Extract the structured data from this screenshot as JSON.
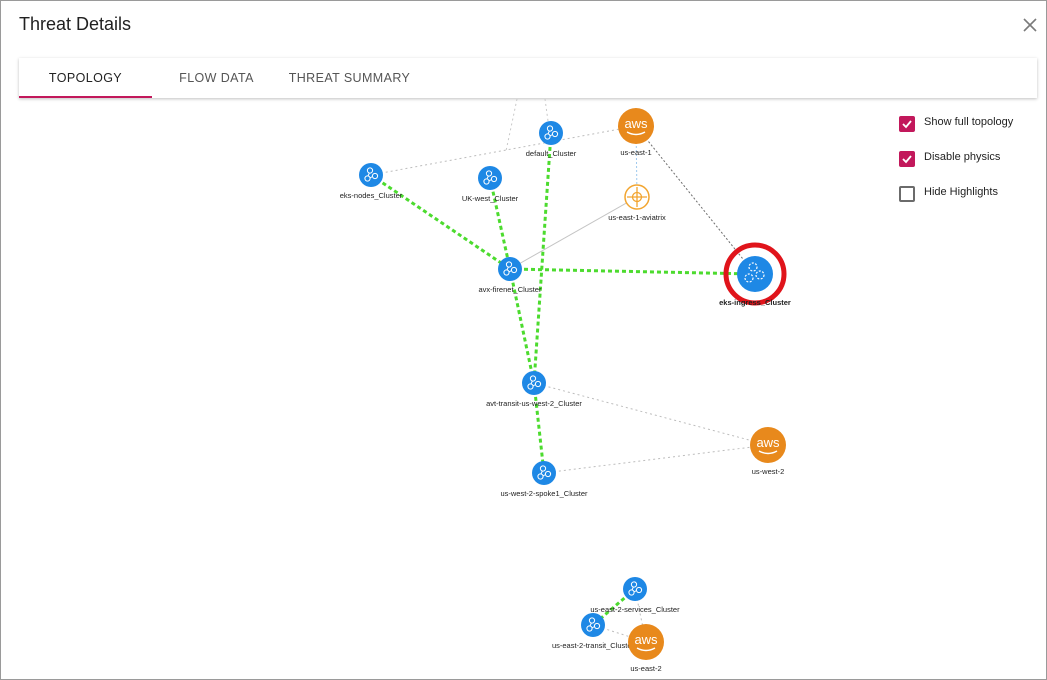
{
  "dialog": {
    "title": "Threat Details",
    "close_icon": "close-icon"
  },
  "tabs": [
    {
      "label": "TOPOLOGY",
      "active": true
    },
    {
      "label": "FLOW DATA",
      "active": false
    },
    {
      "label": "THREAT SUMMARY",
      "active": false
    }
  ],
  "options": [
    {
      "label": "Show full topology",
      "checked": true
    },
    {
      "label": "Disable physics",
      "checked": true
    },
    {
      "label": "Hide Highlights",
      "checked": false
    }
  ],
  "colors": {
    "accent": "#c2185b",
    "cluster_node": "#1e88e5",
    "aws_node": "#e8891c",
    "aviatrix_node": "#f2a530",
    "highlight_edge": "#4cdb2e",
    "selected_ring": "#e0141b"
  },
  "topology": {
    "nodes": [
      {
        "id": "default",
        "label": "default_Cluster",
        "kind": "cluster"
      },
      {
        "id": "us-east-1",
        "label": "us-east-1",
        "kind": "aws"
      },
      {
        "id": "eks-nodes",
        "label": "eks-nodes_Cluster",
        "kind": "cluster"
      },
      {
        "id": "uk-west",
        "label": "UK-west_Cluster",
        "kind": "cluster"
      },
      {
        "id": "us-east-1-aviatrix",
        "label": "us-east-1-aviatrix",
        "kind": "aviatrix"
      },
      {
        "id": "avx-firenet",
        "label": "avx-firenet_Cluster",
        "kind": "cluster"
      },
      {
        "id": "eks-ingress",
        "label": "eks-ingress_Cluster",
        "kind": "cluster",
        "selected": true
      },
      {
        "id": "avt-transit",
        "label": "avt-transit-us-west-2_Cluster",
        "kind": "cluster"
      },
      {
        "id": "us-west-2",
        "label": "us-west-2",
        "kind": "aws"
      },
      {
        "id": "us-west-2-spoke1",
        "label": "us-west-2-spoke1_Cluster",
        "kind": "cluster"
      },
      {
        "id": "us-east-2-services",
        "label": "us-east-2-services_Cluster",
        "kind": "cluster"
      },
      {
        "id": "us-east-2-transit",
        "label": "us-east-2-transit_Cluster",
        "kind": "cluster"
      },
      {
        "id": "us-east-2",
        "label": "us-east-2",
        "kind": "aws"
      }
    ],
    "edges": [
      {
        "from": "eks-nodes",
        "to": "avx-firenet",
        "style": "highlight"
      },
      {
        "from": "uk-west",
        "to": "avx-firenet",
        "style": "highlight"
      },
      {
        "from": "default",
        "to": "avt-transit",
        "style": "highlight"
      },
      {
        "from": "avx-firenet",
        "to": "eks-ingress",
        "style": "highlight"
      },
      {
        "from": "avx-firenet",
        "to": "avt-transit",
        "style": "highlight"
      },
      {
        "from": "avt-transit",
        "to": "us-west-2-spoke1",
        "style": "highlight"
      },
      {
        "from": "us-east-2-services",
        "to": "us-east-2-transit",
        "style": "highlight"
      },
      {
        "from": "eks-nodes",
        "to": "us-east-1",
        "style": "dotted"
      },
      {
        "from": "us-east-1",
        "to": "eks-ingress",
        "style": "dotted-dark"
      },
      {
        "from": "us-east-1",
        "to": "us-east-1-aviatrix",
        "style": "dotted-blue"
      },
      {
        "from": "us-east-1-aviatrix",
        "to": "avx-firenet",
        "style": "solid-gray"
      },
      {
        "from": "avt-transit",
        "to": "us-west-2",
        "style": "dotted"
      },
      {
        "from": "us-west-2-spoke1",
        "to": "us-west-2",
        "style": "dotted"
      },
      {
        "from": "us-east-2-transit",
        "to": "us-east-2",
        "style": "dotted"
      },
      {
        "from": "us-east-2-services",
        "to": "us-east-2",
        "style": "dotted"
      }
    ],
    "aws_badge_text": "aws"
  }
}
